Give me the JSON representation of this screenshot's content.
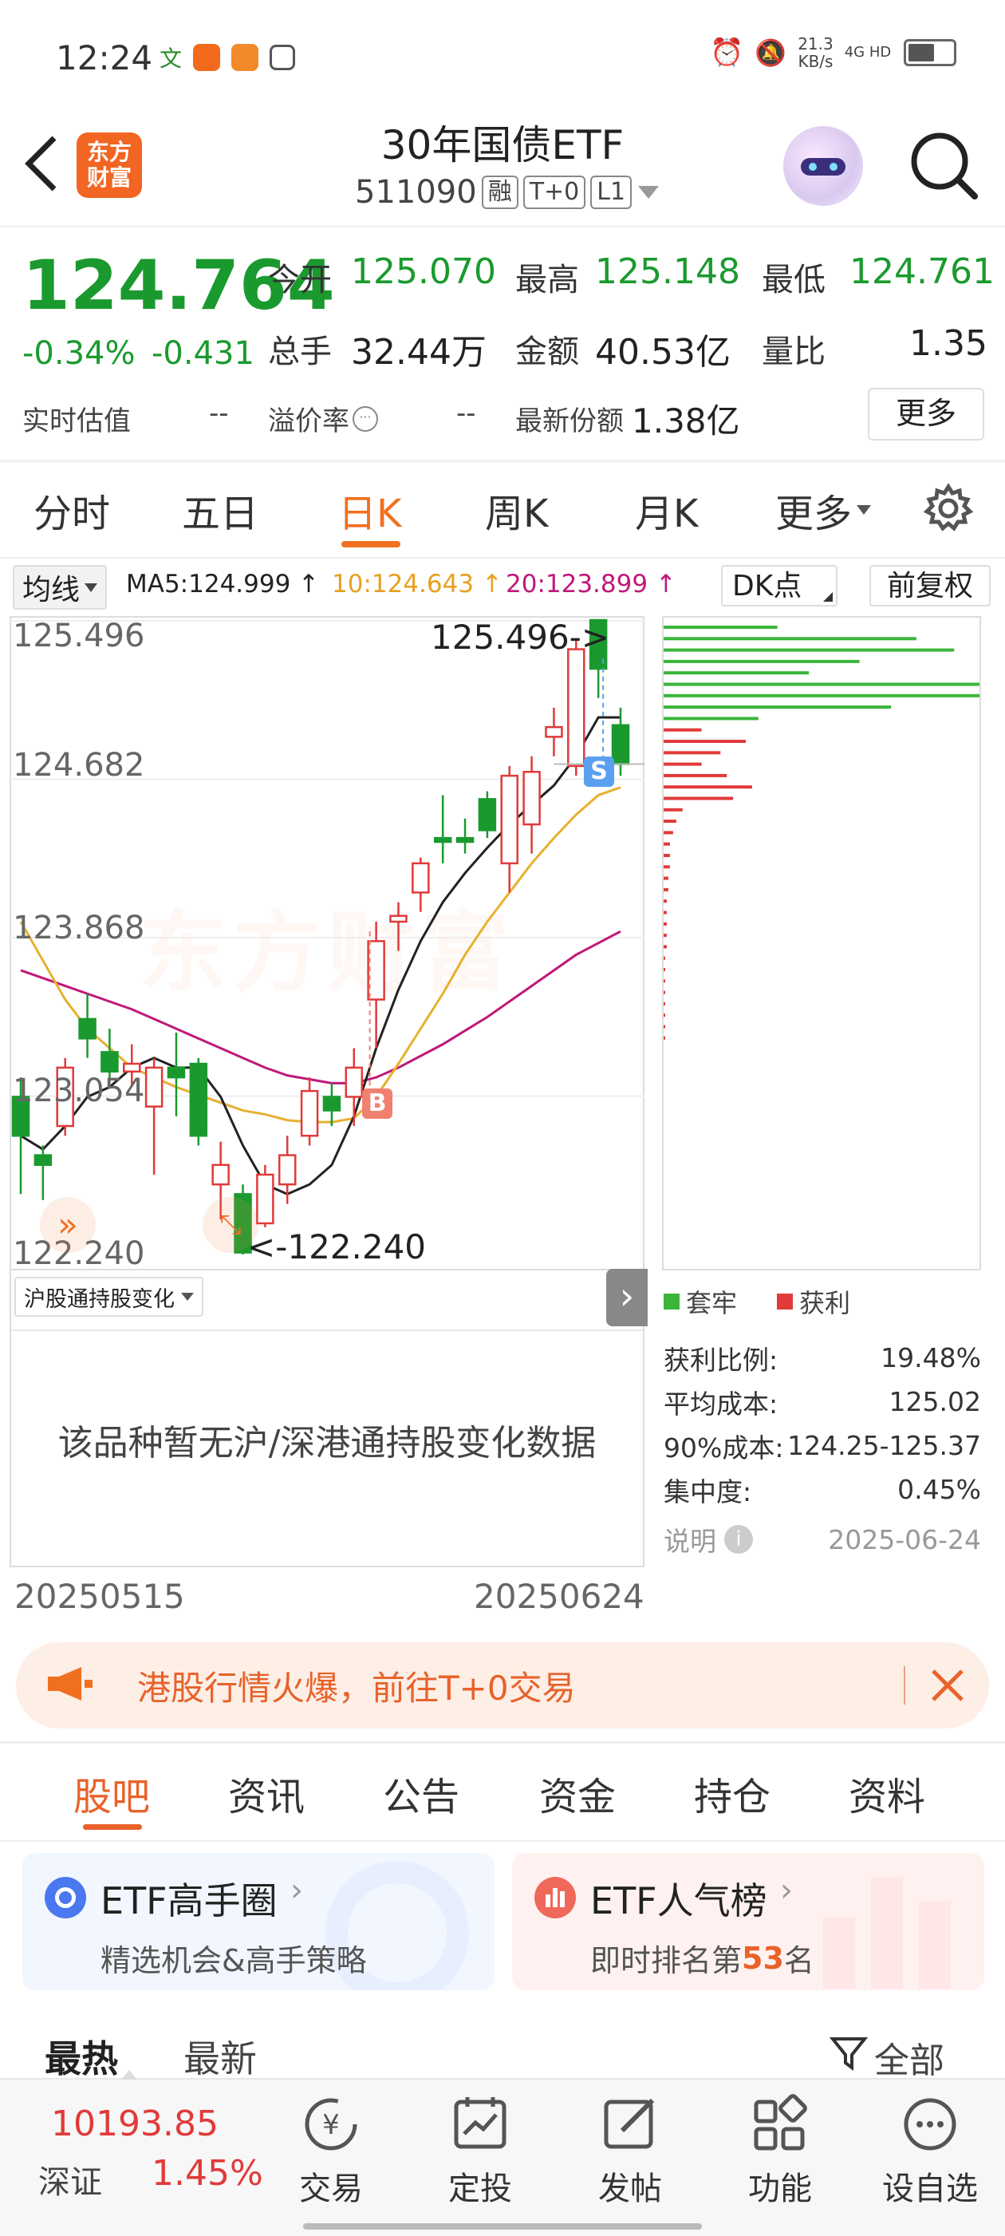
{
  "status": {
    "time": "12:24",
    "net_speed": "21.3",
    "net_unit": "KB/s",
    "net_type": "4G HD"
  },
  "header": {
    "title": "30年国债ETF",
    "code": "511090",
    "tags": [
      "融",
      "T+0",
      "L1"
    ],
    "logo_text_1": "东方",
    "logo_text_2": "财富"
  },
  "quote": {
    "price": "124.764",
    "change_pct": "-0.34%",
    "change": "-0.431",
    "open_label": "今开",
    "open": "125.070",
    "high_label": "最高",
    "high": "125.148",
    "low_label": "最低",
    "low": "124.761",
    "volume_label": "总手",
    "volume": "32.44万",
    "amount_label": "金额",
    "amount": "40.53亿",
    "ratio_label": "量比",
    "ratio": "1.35",
    "iopv_label": "实时估值",
    "iopv": "--",
    "premium_label": "溢价率",
    "premium": "--",
    "shares_label": "最新份额",
    "shares": "1.38亿",
    "more_label": "更多"
  },
  "tabs": [
    "分时",
    "五日",
    "日K",
    "周K",
    "月K",
    "更多"
  ],
  "active_tab": "日K",
  "indicator": {
    "ma_label": "均线",
    "ma5": "MA5:124.999 ↑",
    "ma10": "10:124.643 ↑",
    "ma20": "20:123.899 ↑",
    "dk_label": "DK点",
    "adjust_label": "前复权"
  },
  "chart": {
    "ticks": [
      "125.496",
      "124.682",
      "123.868",
      "123.054",
      "122.240"
    ],
    "max_label": "125.496->",
    "min_label": "<-122.240",
    "buy_marker": "B",
    "sell_marker": "S",
    "watermark": "东方财富",
    "date_start": "20250515",
    "date_end": "20250624"
  },
  "chip": {
    "legend_trap": "套牢",
    "legend_profit": "获利",
    "profit_ratio_label": "获利比例:",
    "profit_ratio": "19.48%",
    "avg_cost_label": "平均成本:",
    "avg_cost": "125.02",
    "cost90_label": "90%成本:",
    "cost90": "124.25-125.37",
    "concentration_label": "集中度:",
    "concentration": "0.45%",
    "note_label": "说明",
    "date": "2025-06-24"
  },
  "hk": {
    "select_label": "沪股通持股变化",
    "empty_text": "该品种暂无沪/深港通持股变化数据"
  },
  "banner": {
    "text": "港股行情火爆，前往T+0交易"
  },
  "subtabs": [
    "股吧",
    "资讯",
    "公告",
    "资金",
    "持仓",
    "资料"
  ],
  "cards": [
    {
      "title": "ETF高手圈",
      "subtitle": "精选机会&高手策略"
    },
    {
      "title": "ETF人气榜",
      "subtitle_pre": "即时排名第",
      "rank": "53",
      "subtitle_post": "名"
    }
  ],
  "feed_tabs": [
    "最热",
    "最新"
  ],
  "filter_label": "全部",
  "bottom": {
    "index_value": "10193.85",
    "index_name": "深证",
    "index_pct": "1.45%",
    "nav": [
      "交易",
      "定投",
      "发帖",
      "功能",
      "设自选"
    ]
  },
  "colors": {
    "green": "#1a9a2e",
    "red": "#e03a3a",
    "orange": "#f07020",
    "ma5": "#222222",
    "ma10": "#e8b030",
    "ma20": "#c0187a"
  },
  "candles": [
    {
      "o": 123.05,
      "c": 122.85,
      "h": 123.15,
      "l": 122.55
    },
    {
      "o": 122.75,
      "c": 122.7,
      "h": 122.8,
      "l": 122.52
    },
    {
      "o": 122.9,
      "c": 123.2,
      "h": 123.25,
      "l": 122.85
    },
    {
      "o": 123.45,
      "c": 123.35,
      "h": 123.58,
      "l": 123.25
    },
    {
      "o": 123.28,
      "c": 123.18,
      "h": 123.4,
      "l": 123.12
    },
    {
      "o": 123.18,
      "c": 123.22,
      "h": 123.32,
      "l": 123.1
    },
    {
      "o": 123.0,
      "c": 123.2,
      "h": 123.25,
      "l": 122.65
    },
    {
      "o": 123.2,
      "c": 123.15,
      "h": 123.38,
      "l": 122.95
    },
    {
      "o": 123.22,
      "c": 122.85,
      "h": 123.25,
      "l": 122.8
    },
    {
      "o": 122.6,
      "c": 122.7,
      "h": 122.82,
      "l": 122.42
    },
    {
      "o": 122.55,
      "c": 122.25,
      "h": 122.6,
      "l": 122.24
    },
    {
      "o": 122.4,
      "c": 122.65,
      "h": 122.7,
      "l": 122.38
    },
    {
      "o": 122.6,
      "c": 122.75,
      "h": 122.85,
      "l": 122.5
    },
    {
      "o": 122.85,
      "c": 123.08,
      "h": 123.15,
      "l": 122.8
    },
    {
      "o": 123.05,
      "c": 122.98,
      "h": 123.12,
      "l": 122.9
    },
    {
      "o": 123.05,
      "c": 123.2,
      "h": 123.3,
      "l": 122.9
    },
    {
      "o": 123.55,
      "c": 123.85,
      "h": 123.95,
      "l": 123.3
    },
    {
      "o": 123.95,
      "c": 123.98,
      "h": 124.05,
      "l": 123.8
    },
    {
      "o": 124.1,
      "c": 124.25,
      "h": 124.28,
      "l": 124.0
    },
    {
      "o": 124.38,
      "c": 124.36,
      "h": 124.6,
      "l": 124.25
    },
    {
      "o": 124.38,
      "c": 124.36,
      "h": 124.48,
      "l": 124.3
    },
    {
      "o": 124.58,
      "c": 124.42,
      "h": 124.62,
      "l": 124.38
    },
    {
      "o": 124.25,
      "c": 124.7,
      "h": 124.75,
      "l": 124.1
    },
    {
      "o": 124.45,
      "c": 124.72,
      "h": 124.8,
      "l": 124.3
    },
    {
      "o": 124.9,
      "c": 124.95,
      "h": 125.05,
      "l": 124.8
    },
    {
      "o": 124.75,
      "c": 125.35,
      "h": 125.4,
      "l": 124.7
    },
    {
      "o": 125.5,
      "c": 125.25,
      "h": 125.496,
      "l": 125.1
    },
    {
      "o": 124.96,
      "c": 124.76,
      "h": 125.05,
      "l": 124.7
    }
  ],
  "ma5": [
    122.85,
    122.78,
    122.9,
    123.05,
    123.1,
    123.2,
    123.25,
    123.2,
    123.2,
    123.05,
    122.8,
    122.6,
    122.55,
    122.6,
    122.7,
    122.95,
    123.3,
    123.6,
    123.85,
    124.05,
    124.2,
    124.33,
    124.45,
    124.55,
    124.65,
    124.8,
    125.0,
    125.0
  ],
  "ma10": [
    123.95,
    123.75,
    123.55,
    123.4,
    123.3,
    123.2,
    123.15,
    123.1,
    123.06,
    123.02,
    122.98,
    122.96,
    122.93,
    122.92,
    122.92,
    122.94,
    123.05,
    123.22,
    123.4,
    123.58,
    123.78,
    123.95,
    124.1,
    124.25,
    124.38,
    124.5,
    124.6,
    124.64
  ],
  "ma20": [
    123.7,
    123.66,
    123.62,
    123.58,
    123.54,
    123.5,
    123.45,
    123.4,
    123.35,
    123.3,
    123.25,
    123.2,
    123.16,
    123.14,
    123.12,
    123.12,
    123.15,
    123.2,
    123.26,
    123.32,
    123.39,
    123.46,
    123.54,
    123.62,
    123.7,
    123.78,
    123.84,
    123.9
  ],
  "chip_bars": [
    {
      "side": "trap",
      "w": 0.36
    },
    {
      "side": "trap",
      "w": 0.8
    },
    {
      "side": "trap",
      "w": 0.92
    },
    {
      "side": "trap",
      "w": 0.62
    },
    {
      "side": "trap",
      "w": 0.46
    },
    {
      "side": "trap",
      "w": 1.0
    },
    {
      "side": "trap",
      "w": 1.0
    },
    {
      "side": "trap",
      "w": 0.72
    },
    {
      "side": "trap",
      "w": 0.3
    },
    {
      "side": "profit",
      "w": 0.12
    },
    {
      "side": "profit",
      "w": 0.26
    },
    {
      "side": "profit",
      "w": 0.18
    },
    {
      "side": "profit",
      "w": 0.12
    },
    {
      "side": "profit",
      "w": 0.2
    },
    {
      "side": "profit",
      "w": 0.28
    },
    {
      "side": "profit",
      "w": 0.22
    },
    {
      "side": "profit",
      "w": 0.06
    },
    {
      "side": "profit",
      "w": 0.04
    },
    {
      "side": "profit",
      "w": 0.03
    },
    {
      "side": "profit",
      "w": 0.02
    },
    {
      "side": "profit",
      "w": 0.02
    },
    {
      "side": "profit",
      "w": 0.02
    },
    {
      "side": "profit",
      "w": 0.015
    },
    {
      "side": "profit",
      "w": 0.015
    },
    {
      "side": "profit",
      "w": 0.01
    },
    {
      "side": "profit",
      "w": 0.01
    },
    {
      "side": "profit",
      "w": 0.01
    },
    {
      "side": "profit",
      "w": 0.01
    },
    {
      "side": "profit",
      "w": 0.01
    }
  ]
}
